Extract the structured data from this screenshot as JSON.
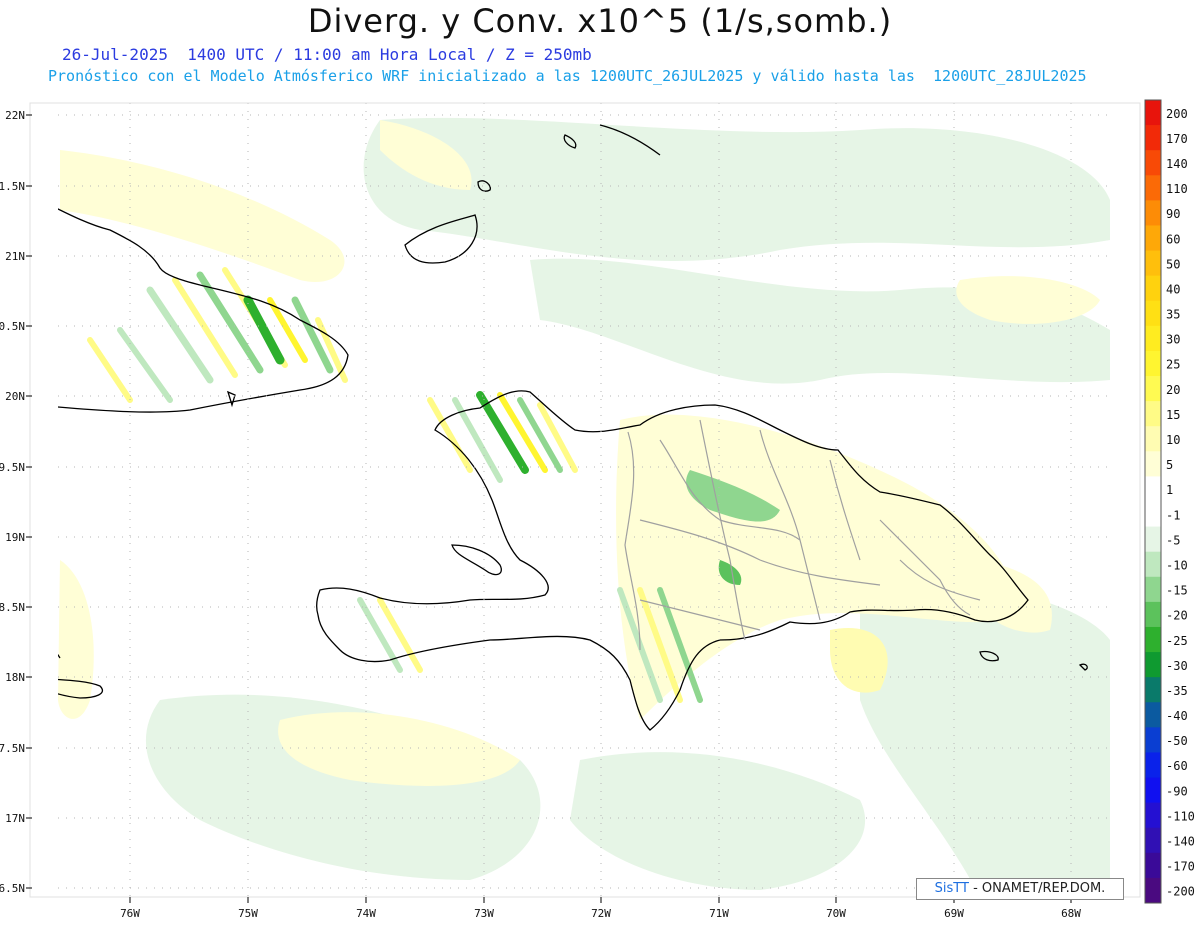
{
  "title": "Diverg. y Conv. x10^5 (1/s,somb.)",
  "subtitle_1": "26-Jul-2025  1400 UTC / 11:00 am Hora Local / Z = 250mb",
  "subtitle_2": "Pronóstico con el Modelo Atmósferico WRF inicializado a las 1200UTC_26JUL2025 y válido hasta las  1200UTC_28JUL2025",
  "lat_labels": [
    "22N",
    "1.5N",
    "21N",
    "0.5N",
    "20N",
    "9.5N",
    "19N",
    "8.5N",
    "18N",
    "7.5N",
    "17N",
    "6.5N"
  ],
  "lon_labels": [
    "76W",
    "75W",
    "74W",
    "73W",
    "72W",
    "71W",
    "70W",
    "69W",
    "68W"
  ],
  "colorbar": [
    {
      "label": "200",
      "color": "#e8140c"
    },
    {
      "label": "170",
      "color": "#f22a08"
    },
    {
      "label": "140",
      "color": "#f84a06"
    },
    {
      "label": "110",
      "color": "#fb6a06"
    },
    {
      "label": "90",
      "color": "#fd8c06"
    },
    {
      "label": "60",
      "color": "#fea808"
    },
    {
      "label": "50",
      "color": "#ffbf0c"
    },
    {
      "label": "40",
      "color": "#ffd20e"
    },
    {
      "label": "35",
      "color": "#ffe014"
    },
    {
      "label": "30",
      "color": "#ffec20"
    },
    {
      "label": "25",
      "color": "#fff530"
    },
    {
      "label": "20",
      "color": "#fffa52"
    },
    {
      "label": "15",
      "color": "#fffb86"
    },
    {
      "label": "10",
      "color": "#fffcb2"
    },
    {
      "label": "5",
      "color": "#fffed6"
    },
    {
      "label": "1",
      "color": "#ffffff"
    },
    {
      "label": "-1",
      "color": "#ffffff"
    },
    {
      "label": "-5",
      "color": "#e6f5e6"
    },
    {
      "label": "-10",
      "color": "#bfe8bf"
    },
    {
      "label": "-15",
      "color": "#8fd68f"
    },
    {
      "label": "-20",
      "color": "#5cc25c"
    },
    {
      "label": "-25",
      "color": "#2eb02e"
    },
    {
      "label": "-30",
      "color": "#0f9a30"
    },
    {
      "label": "-35",
      "color": "#0a7a6a"
    },
    {
      "label": "-40",
      "color": "#0b5aa0"
    },
    {
      "label": "-50",
      "color": "#0a3ed2"
    },
    {
      "label": "-60",
      "color": "#0a22ea"
    },
    {
      "label": "-90",
      "color": "#1010f0"
    },
    {
      "label": "-110",
      "color": "#2410d2"
    },
    {
      "label": "-140",
      "color": "#3010b4"
    },
    {
      "label": "-170",
      "color": "#3a0a98"
    },
    {
      "label": "-200",
      "color": "#4a0a80"
    }
  ],
  "credit": {
    "logo": "SisTT",
    "text": " - ONAMET/REP.DOM."
  }
}
